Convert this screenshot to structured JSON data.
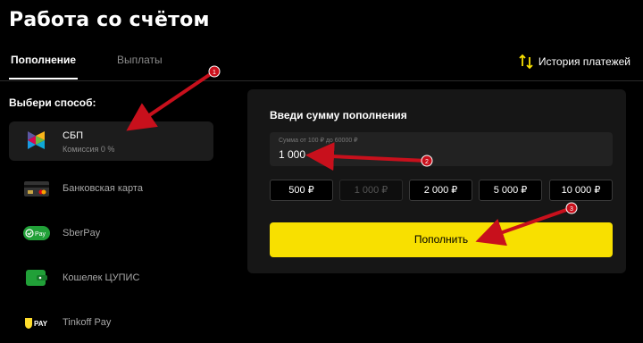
{
  "page_title": "Работа со счётом",
  "tabs": [
    {
      "label": "Пополнение",
      "active": true
    },
    {
      "label": "Выплаты",
      "active": false
    }
  ],
  "history": {
    "label": "История платежей",
    "icon": "swap-vertical-icon"
  },
  "methods_label": "Выбери способ:",
  "methods": [
    {
      "name": "СБП",
      "sub": "Комиссия 0 %",
      "selected": true,
      "icon": "sbp-logo-icon"
    },
    {
      "name": "Банковская карта",
      "sub": "",
      "selected": false,
      "icon": "bank-card-icon"
    },
    {
      "name": "SberPay",
      "sub": "",
      "selected": false,
      "icon": "sberpay-logo-icon"
    },
    {
      "name": "Кошелек ЦУПИС",
      "sub": "",
      "selected": false,
      "icon": "wallet-icon"
    },
    {
      "name": "Tinkoff Pay",
      "sub": "",
      "selected": false,
      "icon": "tinkoff-pay-logo-icon"
    }
  ],
  "deposit": {
    "title": "Введи сумму пополнения",
    "amount_hint": "Сумма от 100 ₽ до 60000 ₽",
    "amount_value": "1 000",
    "quick_amounts": [
      {
        "label": "500 ₽",
        "disabled": false
      },
      {
        "label": "1 000 ₽",
        "disabled": true
      },
      {
        "label": "2 000 ₽",
        "disabled": false
      },
      {
        "label": "5 000 ₽",
        "disabled": false
      },
      {
        "label": "10 000 ₽",
        "disabled": false
      }
    ],
    "submit_label": "Пополнить"
  },
  "annotations": [
    {
      "number": "1"
    },
    {
      "number": "2"
    },
    {
      "number": "3"
    }
  ],
  "colors": {
    "background": "#000000",
    "panel": "#161616",
    "accent_yellow": "#f8e000",
    "annotation_red": "#c8101c"
  }
}
